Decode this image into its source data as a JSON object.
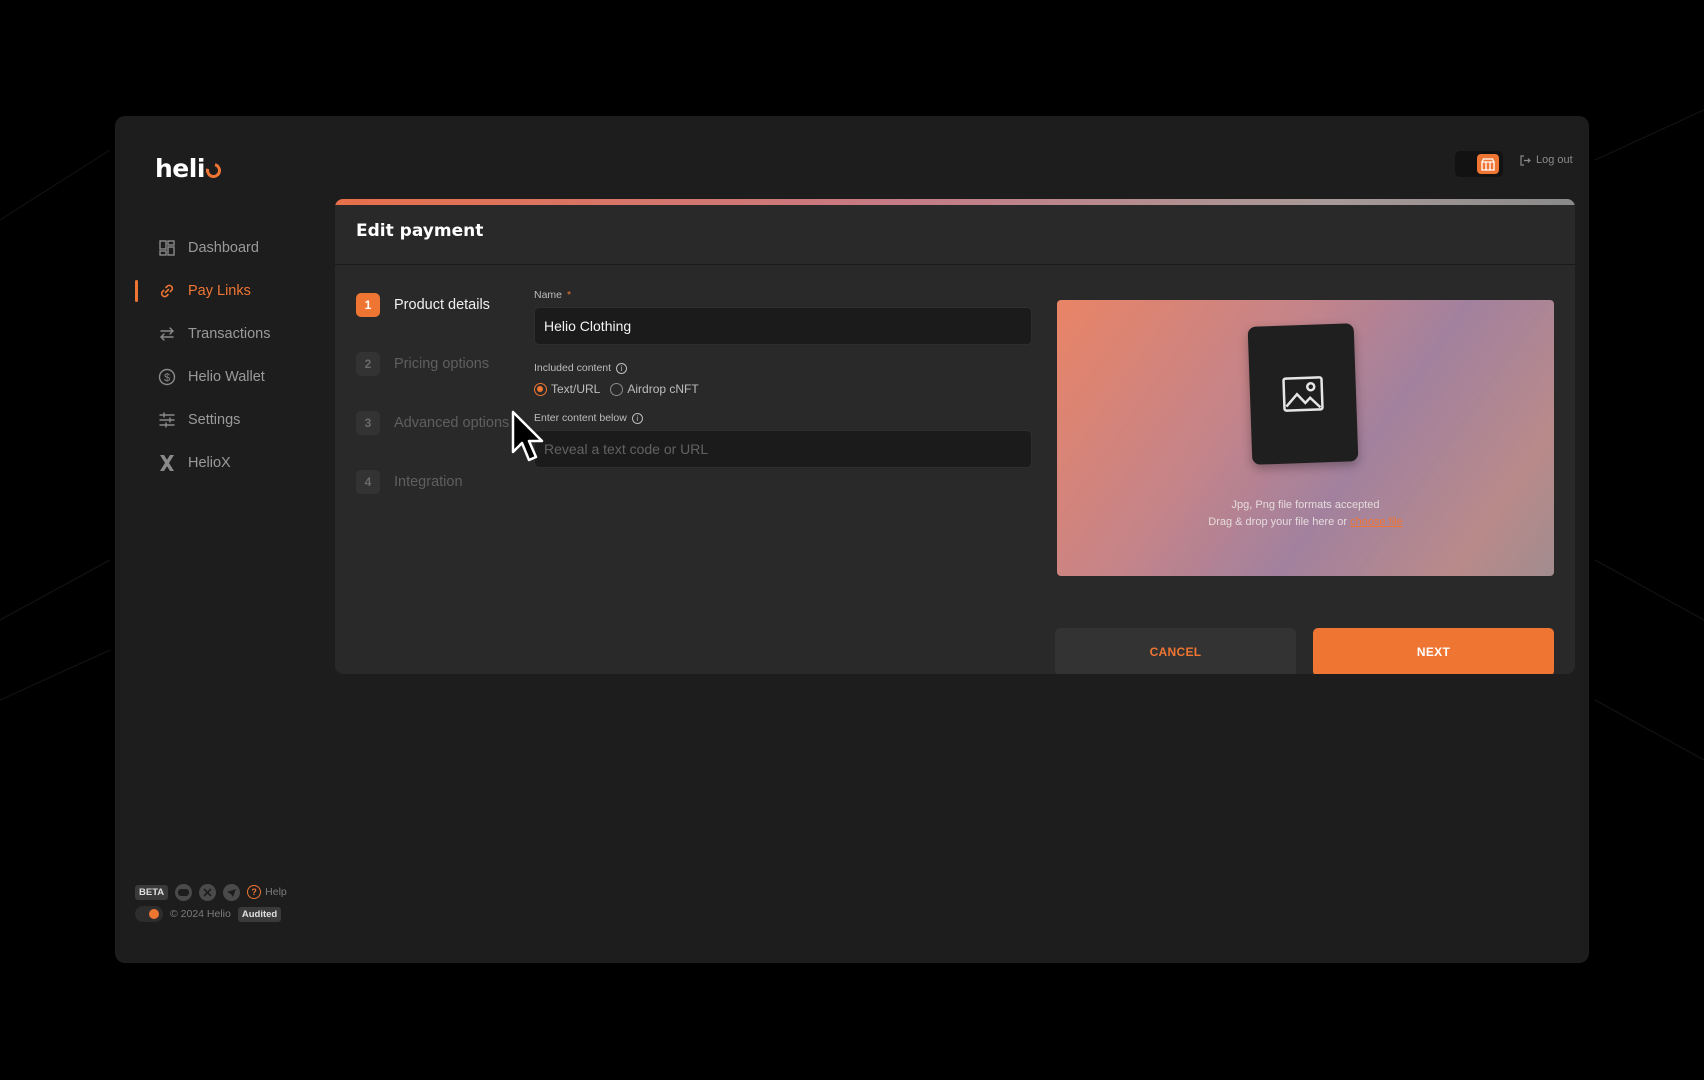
{
  "brand": {
    "name": "heli",
    "accent": "#ef7533"
  },
  "sidebar": {
    "items": [
      {
        "label": "Dashboard",
        "icon": "dashboard-icon",
        "active": false
      },
      {
        "label": "Pay Links",
        "icon": "link-icon",
        "active": true
      },
      {
        "label": "Transactions",
        "icon": "transfer-icon",
        "active": false
      },
      {
        "label": "Helio Wallet",
        "icon": "dollar-circle-icon",
        "active": false
      },
      {
        "label": "Settings",
        "icon": "sliders-icon",
        "active": false
      },
      {
        "label": "HelioX",
        "icon": "x-logo-icon",
        "active": false
      }
    ],
    "footer": {
      "beta": "BETA",
      "help": "Help",
      "copyright": "© 2024 Helio",
      "audited": "Audited"
    }
  },
  "header": {
    "logout": "Log out"
  },
  "card": {
    "title": "Edit payment",
    "steps": [
      {
        "num": "1",
        "label": "Product details",
        "active": true
      },
      {
        "num": "2",
        "label": "Pricing options",
        "active": false
      },
      {
        "num": "3",
        "label": "Advanced options",
        "active": false
      },
      {
        "num": "4",
        "label": "Integration",
        "active": false
      }
    ],
    "form": {
      "name_label": "Name",
      "name_required": "*",
      "name_value": "Helio Clothing",
      "included_label": "Included content",
      "radio_text": "Text/URL",
      "radio_airdrop": "Airdrop cNFT",
      "content_label": "Enter content below",
      "content_placeholder": "Reveal a text code or URL"
    },
    "upload": {
      "formats": "Jpg, Png file formats accepted",
      "drag_text": "Drag & drop your file here or",
      "choose": "choose file"
    },
    "buttons": {
      "cancel": "CANCEL",
      "next": "NEXT"
    }
  }
}
